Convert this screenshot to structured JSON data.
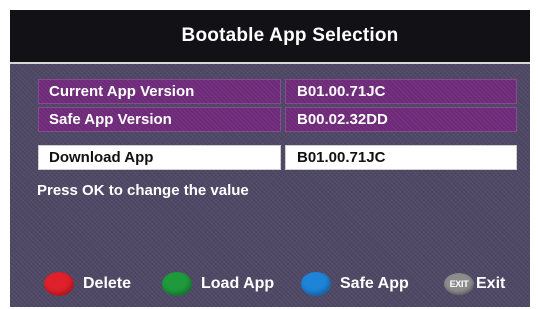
{
  "title": "Bootable App Selection",
  "rows": [
    {
      "label": "Current App Version",
      "value": "B01.00.71JC",
      "style": "purple"
    },
    {
      "label": "Safe App Version",
      "value": "B00.02.32DD",
      "style": "purple"
    },
    {
      "label": "Download App",
      "value": "B01.00.71JC",
      "style": "white"
    }
  ],
  "hint": "Press OK to change the value",
  "legend": {
    "delete": {
      "label": "Delete",
      "color": "#e0202a",
      "icon": "red-button-icon"
    },
    "load_app": {
      "label": "Load App",
      "color": "#1e9a3c",
      "icon": "green-button-icon"
    },
    "safe_app": {
      "label": "Safe App",
      "color": "#1e84d8",
      "icon": "blue-button-icon"
    },
    "exit": {
      "badge": "EXIT",
      "label": "Exit",
      "icon": "exit-button-icon"
    }
  },
  "colors": {
    "background": "#4e4865",
    "title_bar": "#111116",
    "row_purple": "#6e2a78",
    "row_selected": "#ffffff"
  }
}
